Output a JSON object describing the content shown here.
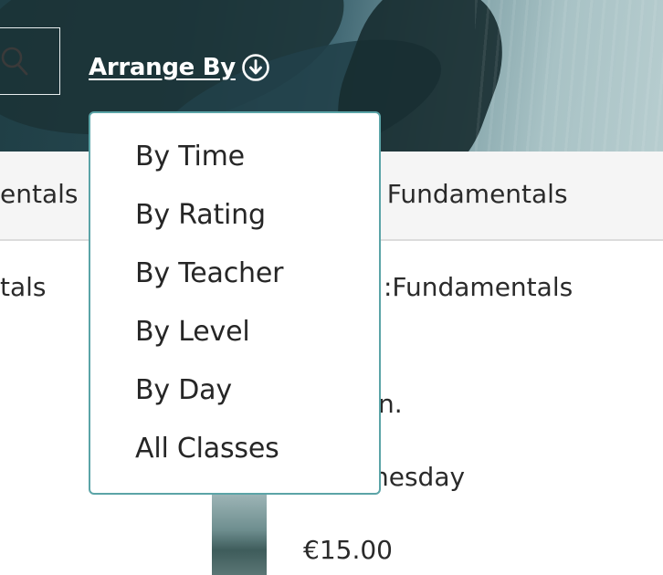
{
  "toolbar": {
    "arrange_label": "Arrange By",
    "search_icon": "search-icon",
    "arrange_icon": "circle-arrow-down-icon"
  },
  "tabs": {
    "left_partial": "entals",
    "right_partial": "w Fundamentals"
  },
  "listing": {
    "title_left_partial": "tals",
    "title_right_partial": ":Fundamentals",
    "detail_partial": "n.",
    "day_partial": "nesday",
    "price": "€15.00"
  },
  "dropdown": {
    "options": [
      "By Time",
      "By Rating",
      "By Teacher",
      "By Level",
      "By Day",
      "All Classes"
    ]
  },
  "colors": {
    "dropdown_border": "#5ba4a7",
    "hero_dark": "#1f3e45"
  }
}
